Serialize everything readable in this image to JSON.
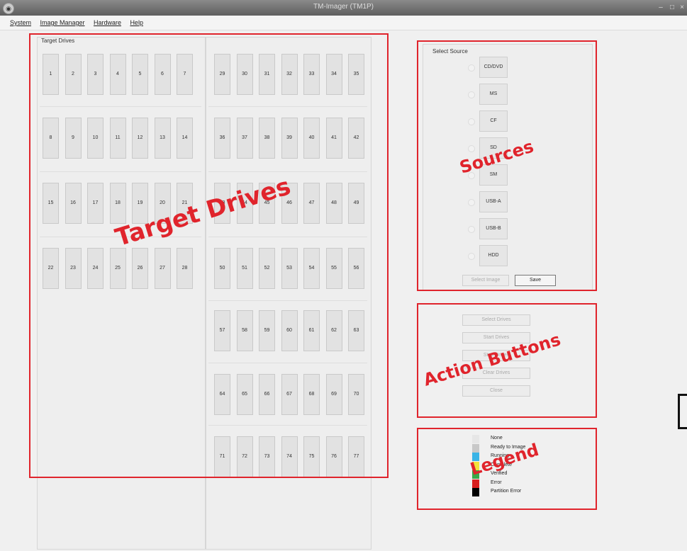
{
  "window": {
    "title": "TM-Imager (TM1P)"
  },
  "menu": [
    "System",
    "Image Manager",
    "Hardware",
    "Help"
  ],
  "target_drives": {
    "label": "Target Drives",
    "left_rows": [
      [
        "1",
        "2",
        "3",
        "4",
        "5",
        "6",
        "7"
      ],
      [
        "8",
        "9",
        "10",
        "11",
        "12",
        "13",
        "14"
      ],
      [
        "15",
        "16",
        "17",
        "18",
        "19",
        "20",
        "21"
      ],
      [
        "22",
        "23",
        "24",
        "25",
        "26",
        "27",
        "28"
      ]
    ],
    "right_rows": [
      [
        "29",
        "30",
        "31",
        "32",
        "33",
        "34",
        "35"
      ],
      [
        "36",
        "37",
        "38",
        "39",
        "40",
        "41",
        "42"
      ],
      [
        "43",
        "44",
        "45",
        "46",
        "47",
        "48",
        "49"
      ],
      [
        "50",
        "51",
        "52",
        "53",
        "54",
        "55",
        "56"
      ],
      [
        "57",
        "58",
        "59",
        "60",
        "61",
        "62",
        "63"
      ],
      [
        "64",
        "65",
        "66",
        "67",
        "68",
        "69",
        "70"
      ],
      [
        "71",
        "72",
        "73",
        "74",
        "75",
        "76",
        "77"
      ]
    ]
  },
  "sources": {
    "label": "Select Source",
    "items": [
      "CD/DVD",
      "MS",
      "CF",
      "SD",
      "SM",
      "USB-A",
      "USB-B",
      "HDD"
    ],
    "select_image_label": "Select Image",
    "save_label": "Save"
  },
  "actions": {
    "buttons": [
      "Select Drives",
      "Start Drives",
      "Stop Drives",
      "Clear Drives",
      "Close"
    ]
  },
  "legend": {
    "items": [
      {
        "label": "None",
        "color": "#e6e6e6"
      },
      {
        "label": "Ready to Image",
        "color": "#c8c8c8"
      },
      {
        "label": "Running",
        "color": "#3ab4e6"
      },
      {
        "label": "Complete",
        "color": "#f2e23a"
      },
      {
        "label": "Verified",
        "color": "#3aa84a"
      },
      {
        "label": "Error",
        "color": "#d81e1e"
      },
      {
        "label": "Partition Error",
        "color": "#000000"
      }
    ]
  },
  "annotations": {
    "target": "Target Drives",
    "sources": "Sources",
    "actions": "Action Buttons",
    "legend": "Legend"
  }
}
